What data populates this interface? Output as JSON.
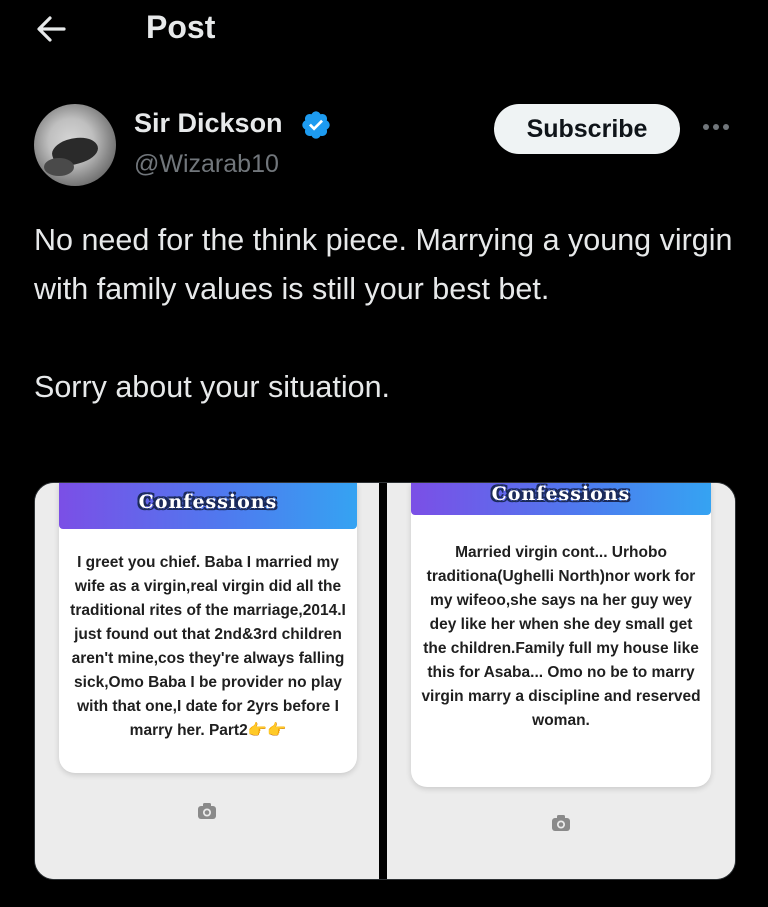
{
  "header": {
    "title": "Post",
    "back_icon": "arrow-left-icon"
  },
  "author": {
    "name": "Sir Dickson",
    "handle": "@Wizarab10",
    "verified": true,
    "verified_color": "#1d9bf0"
  },
  "actions": {
    "subscribe_label": "Subscribe",
    "more_icon": "more-horizontal-icon"
  },
  "tweet": {
    "paragraph1": "No need for the think piece. Marrying a young virgin with family values is still your best bet.",
    "paragraph2": "Sorry about your situation."
  },
  "media": {
    "images": [
      {
        "banner": "Confessions",
        "text": "I greet you chief. Baba I married my wife as a virgin,real virgin did all the traditional rites of the marriage,2014.I just found out that 2nd&3rd children aren't mine,cos they're always falling sick,Omo Baba I be provider no play with that one,I date for 2yrs before I marry her. Part2👉👉"
      },
      {
        "banner": "Confessions",
        "text": "Married virgin cont... Urhobo traditiona(Ughelli North)nor work for my wifeoo,she says na her guy wey dey like her when she dey small get the children.Family full my house like this for Asaba... Omo no be to marry virgin marry a discipline and reserved woman."
      }
    ]
  }
}
